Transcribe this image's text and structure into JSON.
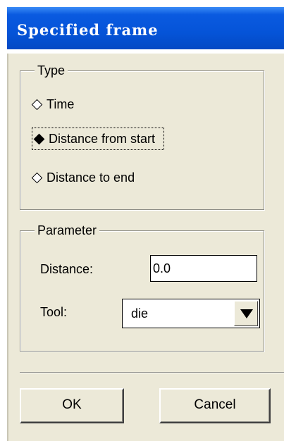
{
  "window": {
    "title": "Specified frame"
  },
  "type_group": {
    "legend": "Type",
    "options": [
      {
        "label": "Time",
        "selected": false
      },
      {
        "label": "Distance from start",
        "selected": true
      },
      {
        "label": "Distance to end",
        "selected": false
      }
    ]
  },
  "parameter_group": {
    "legend": "Parameter",
    "distance_label": "Distance:",
    "distance_value": "0.0",
    "tool_label": "Tool:",
    "tool_value": "die"
  },
  "buttons": {
    "ok": "OK",
    "cancel": "Cancel"
  }
}
